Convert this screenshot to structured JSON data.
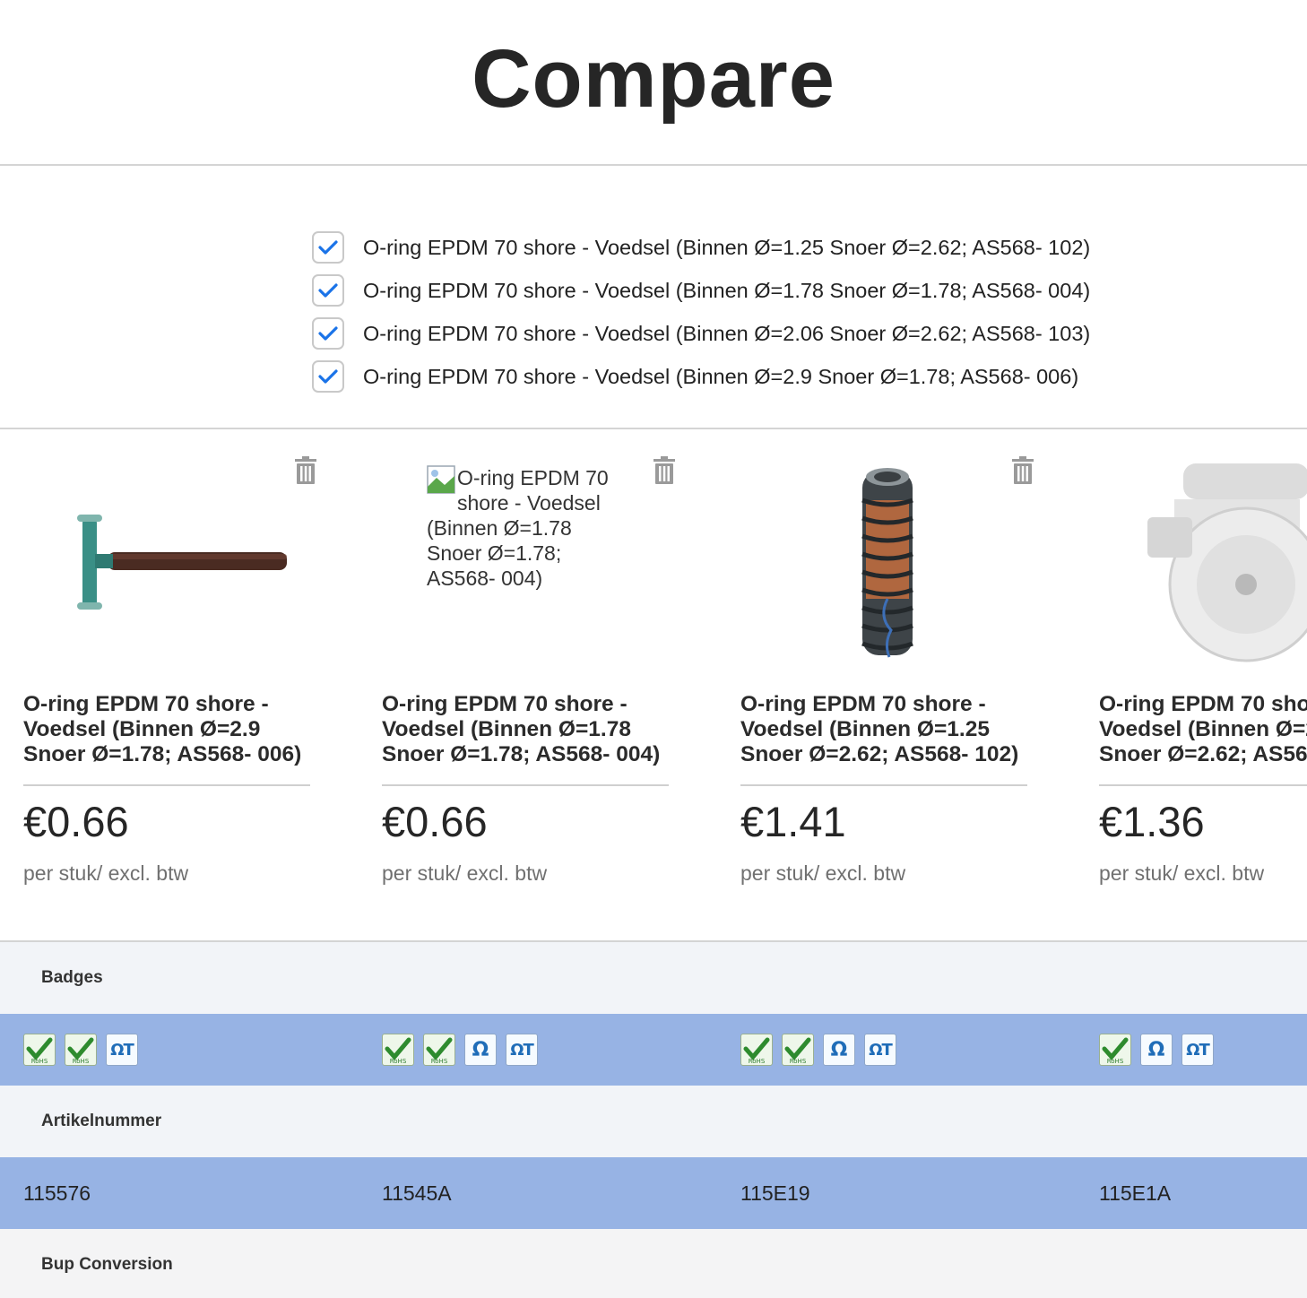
{
  "title": "Compare",
  "selection": [
    {
      "label": "O-ring EPDM 70 shore - Voedsel (Binnen Ø=1.25 Snoer Ø=2.62; AS568- 102)",
      "checked": true
    },
    {
      "label": "O-ring EPDM 70 shore - Voedsel (Binnen Ø=1.78 Snoer Ø=1.78; AS568- 004)",
      "checked": true
    },
    {
      "label": "O-ring EPDM 70 shore - Voedsel (Binnen Ø=2.06 Snoer Ø=2.62; AS568- 103)",
      "checked": true
    },
    {
      "label": "O-ring EPDM 70 shore - Voedsel (Binnen Ø=2.9 Snoer Ø=1.78; AS568- 006)",
      "checked": true
    }
  ],
  "products": [
    {
      "name_lines": [
        "O-ring EPDM 70 shore -",
        "Voedsel (Binnen Ø=2.9",
        "Snoer Ø=1.78; AS568- 006)"
      ],
      "price": "€0.66",
      "unit": "per stuk/ excl. btw",
      "image": "hammer",
      "badges": [
        "rohs",
        "rohs",
        "omega-t"
      ],
      "artikelnummer": "115576"
    },
    {
      "name_lines": [
        "O-ring EPDM 70 shore -",
        "Voedsel (Binnen Ø=1.78",
        "Snoer Ø=1.78; AS568- 004)"
      ],
      "price": "€0.66",
      "unit": "per stuk/ excl. btw",
      "image": "broken",
      "image_alt_lines": [
        "O-ring EPDM 70",
        "shore - Voedsel",
        "(Binnen Ø=1.78",
        "Snoer Ø=1.78;",
        "AS568- 004)"
      ],
      "badges": [
        "rohs",
        "rohs",
        "omega",
        "omega-t"
      ],
      "artikelnummer": "11545A"
    },
    {
      "name_lines": [
        "O-ring EPDM 70 shore -",
        "Voedsel (Binnen Ø=1.25",
        "Snoer Ø=2.62; AS568- 102)"
      ],
      "price": "€1.41",
      "unit": "per stuk/ excl. btw",
      "image": "hose",
      "badges": [
        "rohs",
        "rohs",
        "omega",
        "omega-t"
      ],
      "artikelnummer": "115E19"
    },
    {
      "name_lines": [
        "O-ring EPDM 70 sho",
        "Voedsel (Binnen Ø=2",
        "Snoer Ø=2.62; AS56"
      ],
      "price": "€1.36",
      "unit": "per stuk/ excl. btw",
      "image": "caster",
      "badges": [
        "rohs",
        "omega",
        "omega-t"
      ],
      "artikelnummer": "115E1A"
    }
  ],
  "specs": {
    "badges_label": "Badges",
    "artikelnummer_label": "Artikelnummer",
    "bup_label": "Bup Conversion"
  },
  "badge_text": {
    "rohs": "RoHS",
    "omega": "Ω",
    "omega_t": "ΩT"
  },
  "colors": {
    "accent_check": "#1a73e8",
    "row_highlight": "#97b3e4",
    "header_bg": "#f2f4f8"
  }
}
